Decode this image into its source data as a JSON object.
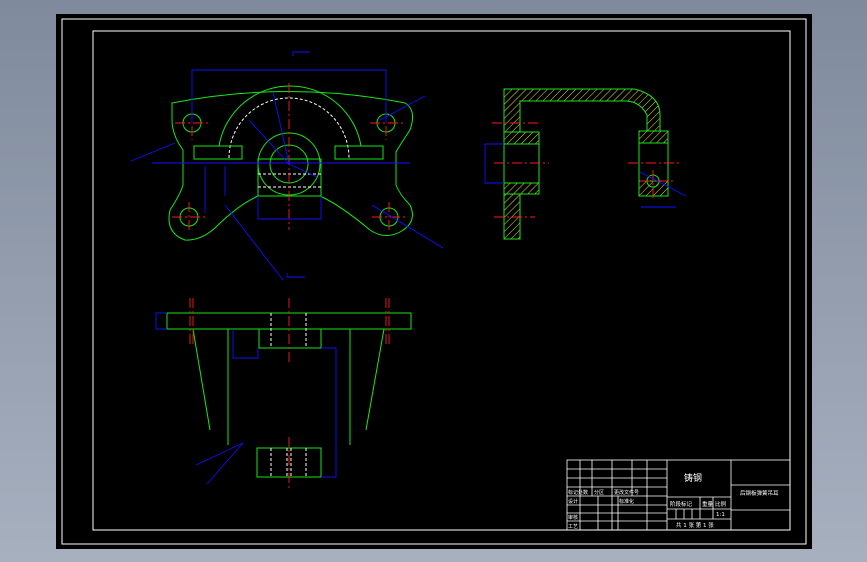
{
  "colors": {
    "background": "#8c97a8",
    "sheet": "#000000",
    "outline": "#19e619",
    "dimension": "#1010ff",
    "centerline": "#ff1a1a",
    "hidden": "#ffffff",
    "hatch": "#e6e619"
  },
  "title_block": {
    "material": "铸钢",
    "drawing_name": "后钢板弹簧吊耳",
    "labels": {
      "mark": "标记处数",
      "zone": "分区",
      "change_doc": "更改文件号",
      "design": "设计",
      "standard": "标准化",
      "review": "审核",
      "process": "工艺",
      "stage": "阶段标记",
      "weight": "重量",
      "scale": "比例"
    },
    "scale_value": "1:1",
    "sheets": "共 1 张 第 1 张"
  }
}
